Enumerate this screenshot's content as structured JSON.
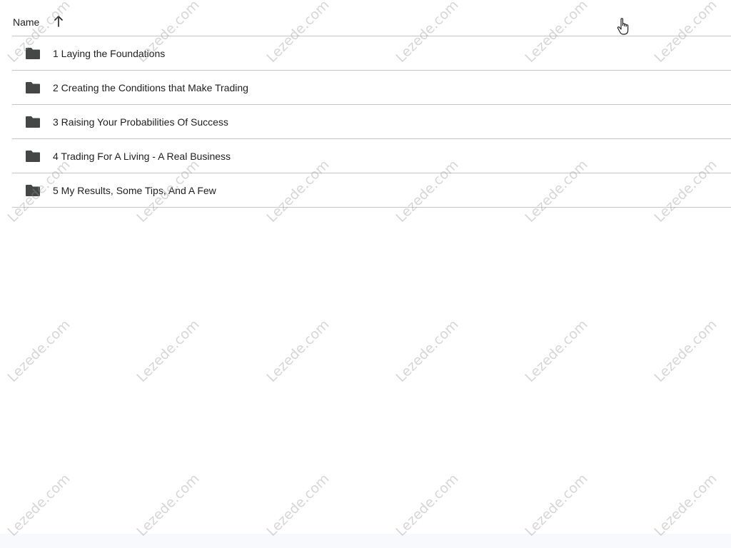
{
  "header": {
    "name_label": "Name",
    "sort_icon": "arrow-up-icon"
  },
  "folders": [
    {
      "label": "1 Laying the Foundations",
      "icon": "folder-icon"
    },
    {
      "label": "2 Creating the Conditions that Make Trading",
      "icon": "folder-icon"
    },
    {
      "label": "3 Raising Your Probabilities Of Success",
      "icon": "folder-icon"
    },
    {
      "label": "4 Trading For A Living - A Real Business",
      "icon": "folder-icon"
    },
    {
      "label": "5 My Results, Some Tips, And A Few",
      "icon": "folder-icon"
    }
  ],
  "watermark": "Lezede.com",
  "colors": {
    "text": "#1f1f1f",
    "divider": "#c7c7c7",
    "folder": "#444746"
  }
}
